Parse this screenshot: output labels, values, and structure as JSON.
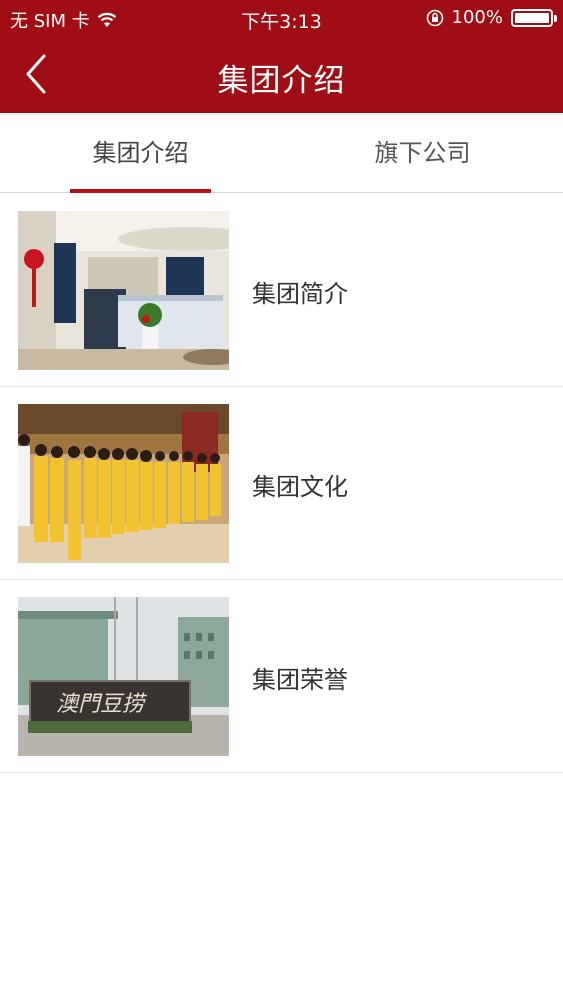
{
  "status_bar": {
    "carrier": "无 SIM 卡",
    "time": "下午3:13",
    "battery": "100%",
    "icons": [
      "wifi-icon",
      "rotation-lock-icon",
      "battery-icon"
    ]
  },
  "nav": {
    "title": "集团介绍",
    "back_icon": "chevron-left-icon"
  },
  "tabs": [
    {
      "label": "集团介绍",
      "active": true
    },
    {
      "label": "旗下公司",
      "active": false
    }
  ],
  "items": [
    {
      "label": "集团简介",
      "image": "reception-lobby"
    },
    {
      "label": "集团文化",
      "image": "staff-lineup"
    },
    {
      "label": "集团荣誉",
      "image": "company-entrance-sign"
    }
  ],
  "entrance_sign": "澳門豆捞",
  "colors": {
    "brand_red": "#a10d15",
    "tab_indicator": "#b30f18"
  }
}
